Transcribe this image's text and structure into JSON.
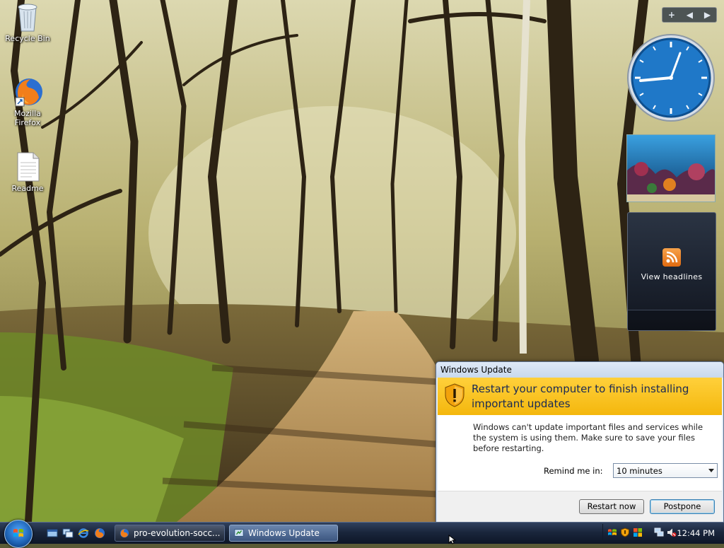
{
  "desktop": {
    "icons": [
      {
        "label": "Recycle Bin"
      },
      {
        "label": "Mozilla Firefox"
      },
      {
        "label": "Readme"
      }
    ]
  },
  "gadgets": {
    "toolbar_add": "+",
    "feed_headlines": {
      "label": "View headlines"
    }
  },
  "dialog": {
    "title": "Windows Update",
    "headline": "Restart your computer to finish installing important updates",
    "message": "Windows can't update important files and services while the system is using them. Make sure to save your files before restarting.",
    "remind_label": "Remind me in:",
    "remind_value": "10 minutes",
    "restart_button": "Restart now",
    "postpone_button": "Postpone",
    "colors": {
      "banner": "#f4b70d",
      "headline": "#1a2a55"
    }
  },
  "taskbar": {
    "tasks": [
      {
        "label": "pro-evolution-socc...",
        "icon": "firefox-icon",
        "active": false
      },
      {
        "label": "Windows Update",
        "icon": "windows-update-icon",
        "active": true
      }
    ],
    "clock": "12:44 PM"
  }
}
